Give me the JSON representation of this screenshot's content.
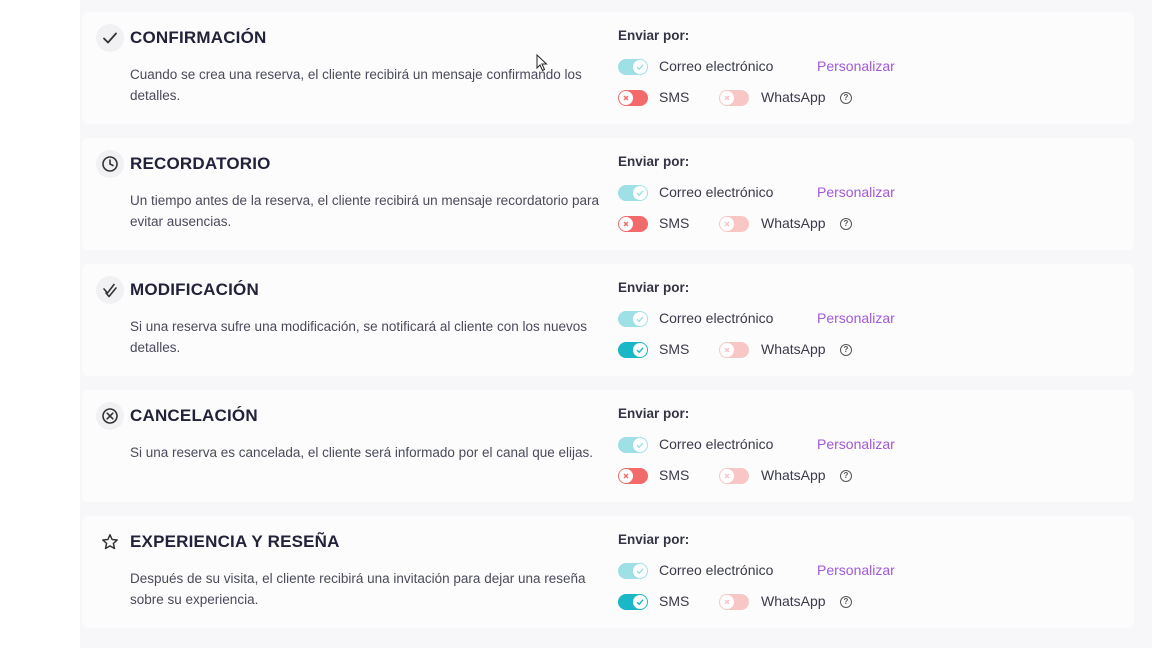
{
  "send_by_label": "Enviar por:",
  "email_label": "Correo electrónico",
  "sms_label": "SMS",
  "whatsapp_label": "WhatsApp",
  "customize_label": "Personalizar",
  "colors": {
    "toggle_on": "#1ab8c6",
    "toggle_off": "#f26a6a",
    "link": "#a259d9"
  },
  "notifications": [
    {
      "icon": "check-icon",
      "title": "CONFIRMACIÓN",
      "description": "Cuando se crea una reserva, el cliente recibirá un mensaje confirmando los detalles.",
      "email": true,
      "sms": false,
      "whatsapp": false
    },
    {
      "icon": "clock-icon",
      "title": "RECORDATORIO",
      "description": "Un tiempo antes de la reserva, el cliente recibirá un mensaje recordatorio para evitar ausencias.",
      "email": true,
      "sms": false,
      "whatsapp": false
    },
    {
      "icon": "double-check-icon",
      "title": "MODIFICACIÓN",
      "description": "Si una reserva sufre una modificación, se notificará al cliente con los nuevos detalles.",
      "email": true,
      "sms": true,
      "whatsapp": false
    },
    {
      "icon": "x-circle-icon",
      "title": "CANCELACIÓN",
      "description": "Si una reserva es cancelada, el cliente será informado por el canal que elijas.",
      "email": true,
      "sms": false,
      "whatsapp": false
    },
    {
      "icon": "star-icon",
      "title": "EXPERIENCIA Y RESEÑA",
      "description": "Después de su visita, el cliente recibirá una invitación para dejar una reseña sobre su experiencia.",
      "email": true,
      "sms": true,
      "whatsapp": false
    }
  ]
}
